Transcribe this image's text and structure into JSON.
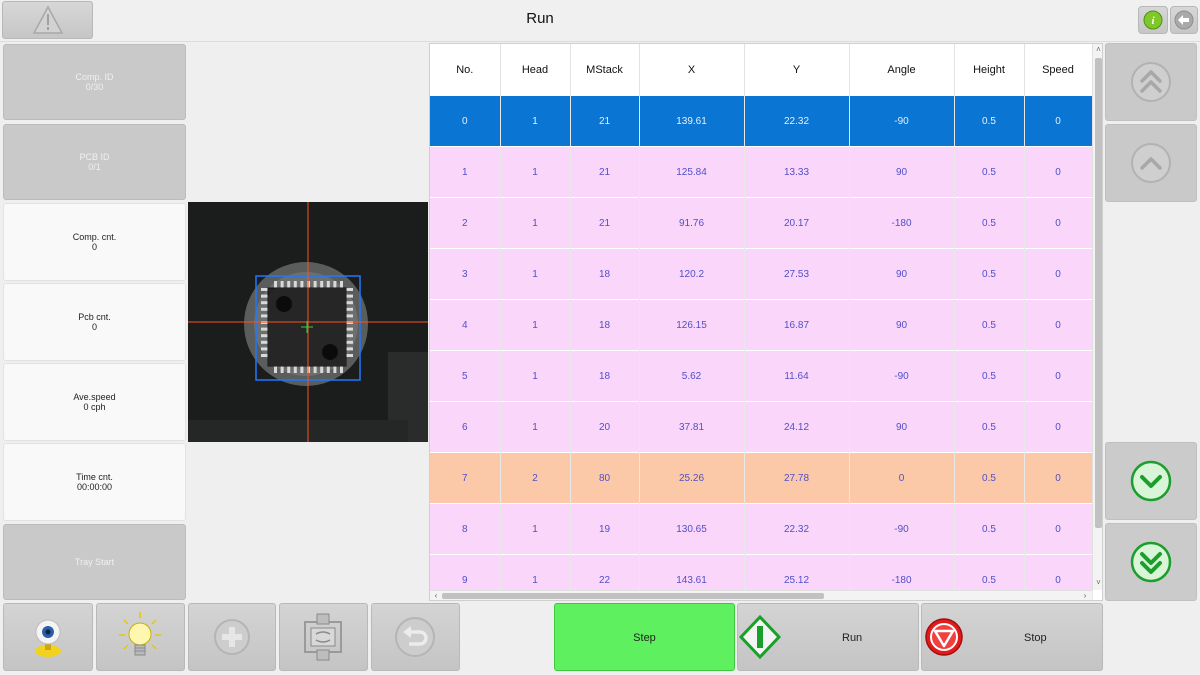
{
  "header": {
    "title": "Run"
  },
  "side_panel": {
    "comp_id": {
      "label": "Comp. ID",
      "value": "0/30"
    },
    "pcb_id": {
      "label": "PCB ID",
      "value": "0/1"
    },
    "comp_cnt": {
      "label": "Comp. cnt.",
      "value": "0"
    },
    "pcb_cnt": {
      "label": "Pcb cnt.",
      "value": "0"
    },
    "ave_speed": {
      "label": "Ave.speed",
      "value": "0 cph"
    },
    "time_cnt": {
      "label": "Time cnt.",
      "value": "00:00:00"
    },
    "tray_start": "Tray Start"
  },
  "table": {
    "columns": [
      "No.",
      "Head",
      "MStack",
      "X",
      "Y",
      "Angle",
      "Height",
      "Speed"
    ],
    "selected_row": 0,
    "rows": [
      {
        "cells": [
          "0",
          "1",
          "21",
          "139.61",
          "22.32",
          "-90",
          "0.5",
          "0"
        ]
      },
      {
        "cells": [
          "1",
          "1",
          "21",
          "125.84",
          "13.33",
          "90",
          "0.5",
          "0"
        ]
      },
      {
        "cells": [
          "2",
          "1",
          "21",
          "91.76",
          "20.17",
          "-180",
          "0.5",
          "0"
        ]
      },
      {
        "cells": [
          "3",
          "1",
          "18",
          "120.2",
          "27.53",
          "90",
          "0.5",
          "0"
        ]
      },
      {
        "cells": [
          "4",
          "1",
          "18",
          "126.15",
          "16.87",
          "90",
          "0.5",
          "0"
        ]
      },
      {
        "cells": [
          "5",
          "1",
          "18",
          "5.62",
          "11.64",
          "-90",
          "0.5",
          "0"
        ]
      },
      {
        "cells": [
          "6",
          "1",
          "20",
          "37.81",
          "24.12",
          "90",
          "0.5",
          "0"
        ]
      },
      {
        "cells": [
          "7",
          "2",
          "80",
          "25.26",
          "27.78",
          "0",
          "0.5",
          "0"
        ]
      },
      {
        "cells": [
          "8",
          "1",
          "19",
          "130.65",
          "22.32",
          "-90",
          "0.5",
          "0"
        ]
      },
      {
        "cells": [
          "9",
          "1",
          "22",
          "143.61",
          "25.12",
          "-180",
          "0.5",
          "0"
        ]
      }
    ]
  },
  "toolbar": {
    "step": "Step",
    "run": "Run",
    "stop": "Stop"
  },
  "colors": {
    "selected_row": "#0a75d2",
    "row_head1": "#fbd6fb",
    "row_head2": "#fbc9a8",
    "step_button": "#5ef05e",
    "crosshair": "#ff5020",
    "detection_box": "#1e78ff"
  },
  "icons": [
    "warning-icon",
    "info-icon",
    "back-arrow-icon",
    "double-chevron-up-icon",
    "chevron-up-icon",
    "chevron-down-icon",
    "double-chevron-down-icon",
    "camera-icon",
    "light-bulb-icon",
    "add-icon",
    "nozzle-change-icon",
    "undo-icon",
    "run-icon",
    "stop-icon"
  ]
}
